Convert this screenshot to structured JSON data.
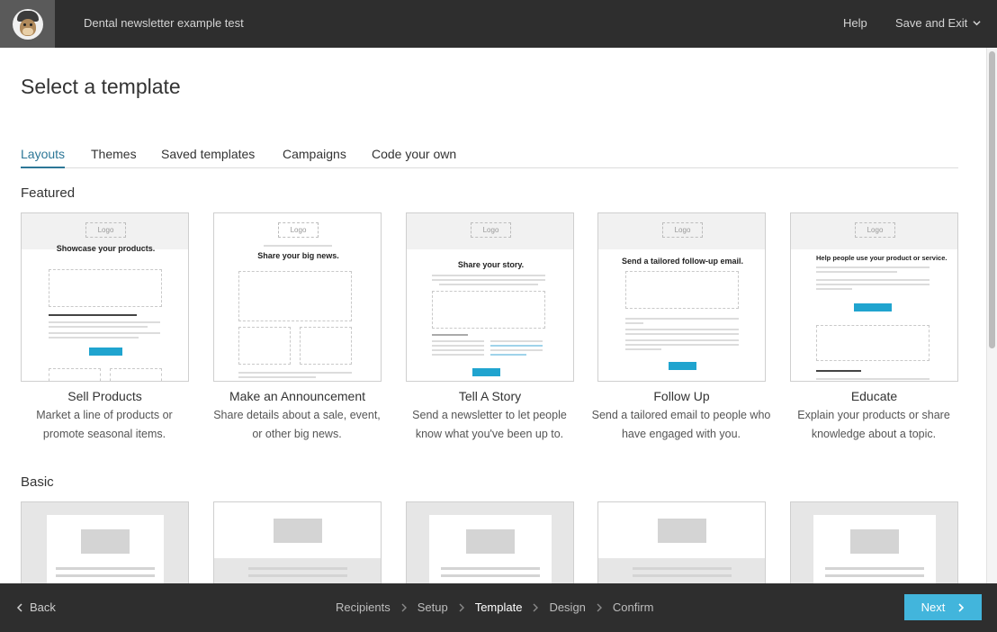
{
  "header": {
    "campaign_title": "Dental newsletter example test",
    "help_label": "Help",
    "save_exit_label": "Save and Exit"
  },
  "page": {
    "title": "Select a template"
  },
  "tabs": [
    {
      "label": "Layouts",
      "active": true
    },
    {
      "label": "Themes",
      "active": false
    },
    {
      "label": "Saved templates",
      "active": false
    },
    {
      "label": "Campaigns",
      "active": false
    },
    {
      "label": "Code your own",
      "active": false
    }
  ],
  "featured": {
    "title": "Featured",
    "cards": [
      {
        "preview_logo": "Logo",
        "preview_title": "Showcase your products.",
        "name": "Sell Products",
        "description": "Market a line of products or promote seasonal items."
      },
      {
        "preview_logo": "Logo",
        "preview_title": "Share your big news.",
        "name": "Make an Announcement",
        "description": "Share details about a sale, event, or other big news."
      },
      {
        "preview_logo": "Logo",
        "preview_title": "Share your story.",
        "name": "Tell A Story",
        "description": "Send a newsletter to let people know what you've been up to."
      },
      {
        "preview_logo": "Logo",
        "preview_title": "Send a tailored follow-up email.",
        "name": "Follow Up",
        "description": "Send a tailored email to people who have engaged with you."
      },
      {
        "preview_logo": "Logo",
        "preview_title": "Help people use your product or service.",
        "name": "Educate",
        "description": "Explain your products or share knowledge about a topic."
      }
    ]
  },
  "basic": {
    "title": "Basic"
  },
  "footer": {
    "back_label": "Back",
    "breadcrumbs": [
      "Recipients",
      "Setup",
      "Template",
      "Design",
      "Confirm"
    ],
    "active_step": "Template",
    "next_label": "Next"
  },
  "colors": {
    "topbar": "#2e2e2e",
    "accent_tab": "#2d7797",
    "next_button": "#42b5dc",
    "preview_button": "#20a4cf"
  }
}
